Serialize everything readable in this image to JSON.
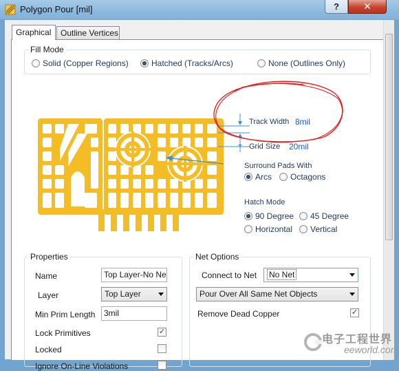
{
  "window": {
    "title": "Polygon Pour [mil]",
    "help_label": "?",
    "close_label": "✕"
  },
  "tabs": [
    {
      "label": "Graphical",
      "active": true
    },
    {
      "label": "Outline Vertices",
      "active": false
    }
  ],
  "fill_mode": {
    "title": "Fill Mode",
    "options": [
      {
        "label": "Solid (Copper Regions)",
        "checked": false
      },
      {
        "label": "Hatched (Tracks/Arcs)",
        "checked": true
      },
      {
        "label": "None (Outlines Only)",
        "checked": false
      }
    ]
  },
  "track_width": {
    "label": "Track Width",
    "value": "8mil"
  },
  "grid_size": {
    "label": "Grid Size",
    "value": "20mil"
  },
  "surround_pads": {
    "title": "Surround Pads With",
    "options": [
      {
        "label": "Arcs",
        "checked": true
      },
      {
        "label": "Octagons",
        "checked": false
      }
    ]
  },
  "hatch_mode": {
    "title": "Hatch Mode",
    "options": [
      {
        "label": "90 Degree",
        "checked": true
      },
      {
        "label": "45 Degree",
        "checked": false
      },
      {
        "label": "Horizontal",
        "checked": false
      },
      {
        "label": "Vertical",
        "checked": false
      }
    ]
  },
  "properties": {
    "title": "Properties",
    "name_label": "Name",
    "name_value": "Top Layer-No Net",
    "layer_label": "Layer",
    "layer_value": "Top Layer",
    "min_prim_label": "Min Prim Length",
    "min_prim_value": "3mil",
    "lock_primitives_label": "Lock Primitives",
    "lock_primitives_checked": true,
    "locked_label": "Locked",
    "locked_checked": false,
    "ignore_online_label": "Ignore On-Line Violations",
    "ignore_online_checked": false
  },
  "net_options": {
    "title": "Net Options",
    "connect_label": "Connect to Net",
    "connect_value": "No Net",
    "pour_over_value": "Pour Over All Same Net Objects",
    "remove_dead_label": "Remove Dead Copper",
    "remove_dead_checked": true
  },
  "check_mark": "✓",
  "watermark": {
    "line1": "电子工程世界",
    "line2": "eeworld.com.cn"
  },
  "colors": {
    "copper": "#f5bd25",
    "annotation_red": "#e02020",
    "dimension_blue": "#3d8fcc",
    "title_bar": "#8db8dd"
  }
}
